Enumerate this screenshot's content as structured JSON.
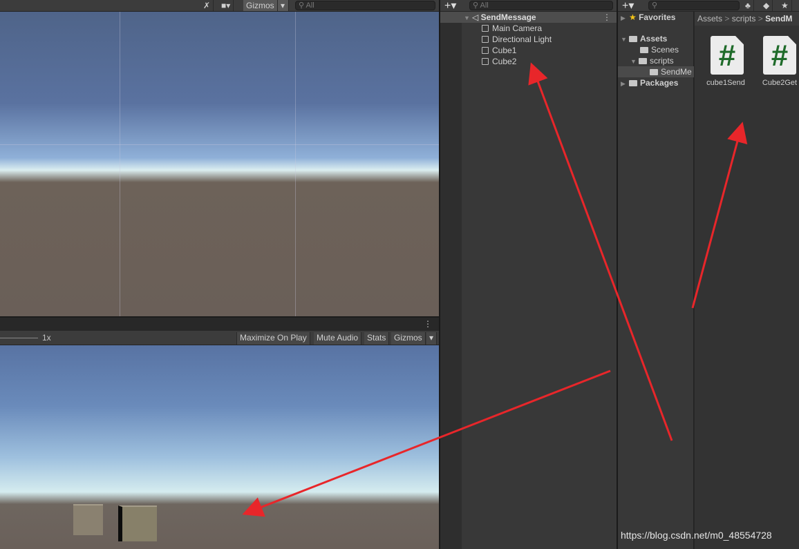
{
  "scene": {
    "gizmos_label": "Gizmos",
    "search_placeholder": "All",
    "icons": [
      "tools-icon",
      "camera-icon",
      "chevron-down-icon",
      "search-icon"
    ]
  },
  "game": {
    "scale_label": "1x",
    "maximize": "Maximize On Play",
    "mute": "Mute Audio",
    "stats": "Stats",
    "gizmos": "Gizmos"
  },
  "hierarchy": {
    "search_placeholder": "All",
    "scene_name": "SendMessage",
    "items": [
      "Main Camera",
      "Directional Light",
      "Cube1",
      "Cube2"
    ]
  },
  "project": {
    "favorites": "Favorites",
    "assets": "Assets",
    "scenes": "Scenes",
    "scripts": "scripts",
    "sendme": "SendMe",
    "packages": "Packages",
    "breadcrumb": [
      "Assets",
      "scripts",
      "SendM"
    ],
    "files": [
      {
        "name": "cube1Send",
        "glyph": "#"
      },
      {
        "name": "Cube2Get",
        "glyph": "#"
      }
    ]
  },
  "watermark": "https://blog.csdn.net/m0_48554728",
  "colors": {
    "annotation_arrow": "#e8262a",
    "script_icon": "#1f6b2a"
  }
}
